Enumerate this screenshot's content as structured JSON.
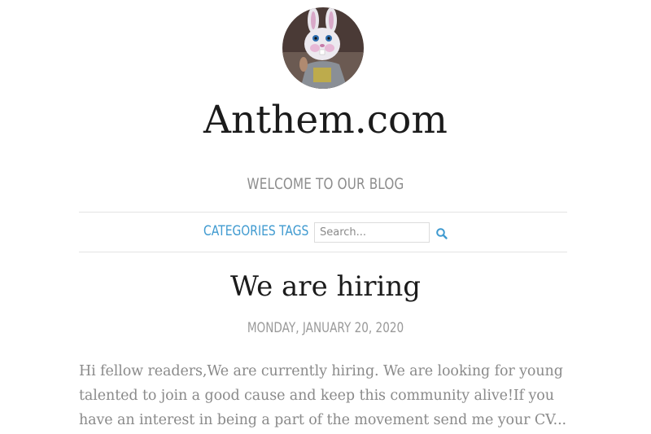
{
  "site": {
    "title": "Anthem.com",
    "tagline": "WELCOME TO OUR BLOG"
  },
  "nav": {
    "categories_label": "CATEGORIES",
    "tags_label": "TAGS"
  },
  "search": {
    "placeholder": "Search..."
  },
  "post": {
    "title": "We are hiring",
    "date": "MONDAY, JANUARY 20, 2020",
    "excerpt": "Hi fellow readers,We are currently hiring. We are looking for young talented to join a good cause and keep this community alive!If you have an interest in being a part of the movement send me your CV..."
  },
  "colors": {
    "link": "#3f9ad0",
    "title": "#1b1b1b",
    "muted": "#8d8d8d",
    "divider": "#e4e4e4"
  },
  "icons": {
    "search": "search-icon",
    "avatar": "bunny-costume-avatar"
  }
}
